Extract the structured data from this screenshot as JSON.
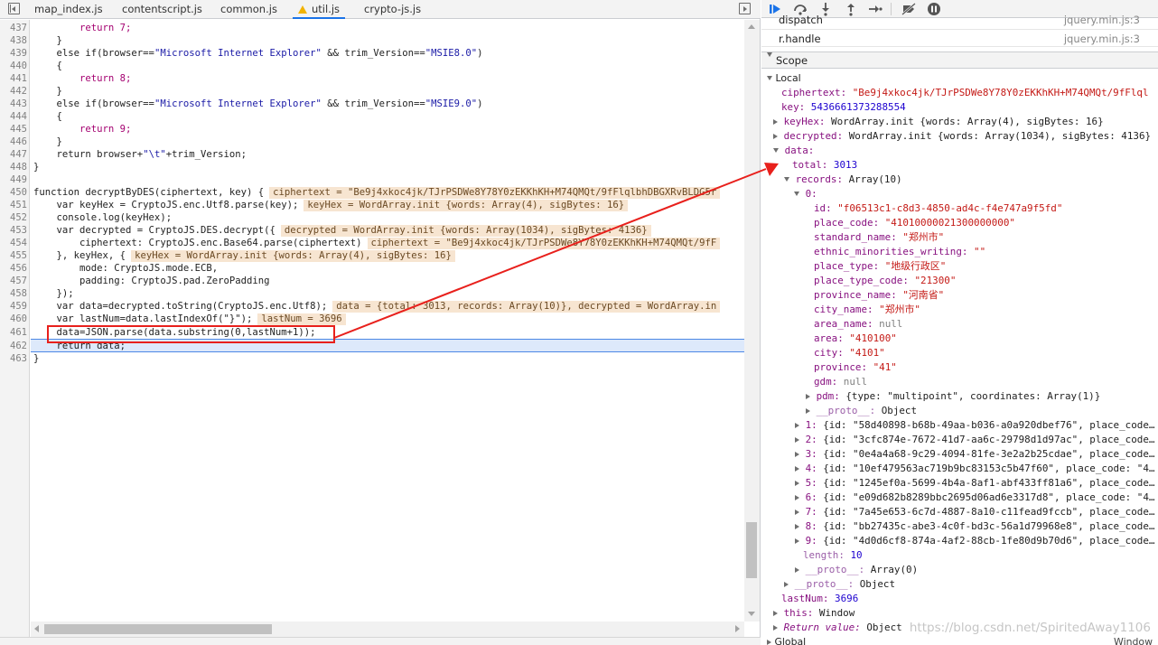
{
  "tabs": [
    {
      "label": "map_index.js"
    },
    {
      "label": "contentscript.js"
    },
    {
      "label": "common.js"
    },
    {
      "label": "util.js"
    },
    {
      "label": "crypto-js.js"
    }
  ],
  "code": {
    "line_numbers": [
      "437",
      "438",
      "439",
      "440",
      "441",
      "442",
      "443",
      "444",
      "445",
      "446",
      "447",
      "448",
      "449",
      "450",
      "451",
      "452",
      "453",
      "454",
      "455",
      "456",
      "457",
      "458",
      "459",
      "460",
      "461",
      "462",
      "463"
    ],
    "l437": "        return 7;",
    "l438": "    }",
    "l439a": "    else if(browser==",
    "l439b": "\"Microsoft Internet Explorer\"",
    "l439c": " && trim_Version==",
    "l439d": "\"MSIE8.0\"",
    "l439e": ")",
    "l440": "    {",
    "l441": "        return 8;",
    "l442": "    }",
    "l443a": "    else if(browser==",
    "l443b": "\"Microsoft Internet Explorer\"",
    "l443c": " && trim_Version==",
    "l443d": "\"MSIE9.0\"",
    "l443e": ")",
    "l444": "    {",
    "l445": "        return 9;",
    "l446": "    }",
    "l447a": "    return browser+",
    "l447b": "\"\\t\"",
    "l447c": "+trim_Version;",
    "l448": "}",
    "l449": "",
    "l450": "function decryptByDES(ciphertext, key) {",
    "l450i": "ciphertext = \"Be9j4xkoc4jk/TJrPSDWe8Y78Y0zEKKhKH+M74QMQt/9fFlqlbhDBGXRvBLDG5r",
    "l451": "    var keyHex = CryptoJS.enc.Utf8.parse(key);",
    "l451i": "keyHex = WordArray.init {words: Array(4), sigBytes: 16}",
    "l452": "    console.log(keyHex);",
    "l453": "    var decrypted = CryptoJS.DES.decrypt({",
    "l453i": "decrypted = WordArray.init {words: Array(1034), sigBytes: 4136}",
    "l454": "        ciphertext: CryptoJS.enc.Base64.parse(ciphertext)",
    "l454i": "ciphertext = \"Be9j4xkoc4jk/TJrPSDWe8Y78Y0zEKKhKH+M74QMQt/9fF",
    "l455": "    }, keyHex, {",
    "l455i": "keyHex = WordArray.init {words: Array(4), sigBytes: 16}",
    "l456": "        mode: CryptoJS.mode.ECB,",
    "l457": "        padding: CryptoJS.pad.ZeroPadding",
    "l458": "    });",
    "l459": "    var data=decrypted.toString(CryptoJS.enc.Utf8);",
    "l459i": "data = {total: 3013, records: Array(10)}, decrypted = WordArray.in",
    "l460": "    var lastNum=data.lastIndexOf(\"}\");",
    "l460i": "lastNum = 3696",
    "l461": "    data=JSON.parse(data.substring(0,lastNum+1));",
    "l462": "    return data;",
    "l463": "}"
  },
  "callstack": [
    {
      "name": "dispatch",
      "file": "jquery.min.js:3"
    },
    {
      "name": "r.handle",
      "file": "jquery.min.js:3"
    }
  ],
  "scope": {
    "header": "Scope",
    "local": "Local",
    "ciphertext_key": "ciphertext:",
    "ciphertext_val": "\"Be9j4xkoc4jk/TJrPSDWe8Y78Y0zEKKhKH+M74QMQt/9fFlql",
    "key_key": "key:",
    "key_val": "5436661373288554",
    "keyHex_key": "keyHex:",
    "keyHex_val": "WordArray.init {words: Array(4), sigBytes: 16}",
    "decrypted_key": "decrypted:",
    "decrypted_val": "WordArray.init {words: Array(1034), sigBytes: 4136}",
    "data_key": "data:",
    "total_key": "total:",
    "total_val": "3013",
    "records_key": "records:",
    "records_val": "Array(10)",
    "rec0_key": "0:",
    "fields": [
      {
        "k": "id:",
        "v": "\"f06513c1-c8d3-4850-ad4c-f4e747a9f5fd\"",
        "t": "s"
      },
      {
        "k": "place_code:",
        "v": "\"41010000021300000000\"",
        "t": "s"
      },
      {
        "k": "standard_name:",
        "v": "\"郑州市\"",
        "t": "s"
      },
      {
        "k": "ethnic_minorities_writing:",
        "v": "\"\"",
        "t": "s"
      },
      {
        "k": "place_type:",
        "v": "\"地级行政区\"",
        "t": "s"
      },
      {
        "k": "place_type_code:",
        "v": "\"21300\"",
        "t": "s"
      },
      {
        "k": "province_name:",
        "v": "\"河南省\"",
        "t": "s"
      },
      {
        "k": "city_name:",
        "v": "\"郑州市\"",
        "t": "s"
      },
      {
        "k": "area_name:",
        "v": "null",
        "t": "null"
      },
      {
        "k": "area:",
        "v": "\"410100\"",
        "t": "s"
      },
      {
        "k": "city:",
        "v": "\"4101\"",
        "t": "s"
      },
      {
        "k": "province:",
        "v": "\"41\"",
        "t": "s"
      },
      {
        "k": "gdm:",
        "v": "null",
        "t": "null"
      }
    ],
    "pdm_key": "pdm:",
    "pdm_val": "{type: \"multipoint\", coordinates: Array(1)}",
    "proto_key": "__proto__:",
    "proto_obj": "Object",
    "records_rest": [
      {
        "k": "1:",
        "v": "{id: \"58d40898-b68b-49aa-b036-a0a920dbef76\", place_code…"
      },
      {
        "k": "2:",
        "v": "{id: \"3cfc874e-7672-41d7-aa6c-29798d1d97ac\", place_code…"
      },
      {
        "k": "3:",
        "v": "{id: \"0e4a4a68-9c29-4094-81fe-3e2a2b25cdae\", place_code…"
      },
      {
        "k": "4:",
        "v": "{id: \"10ef479563ac719b9bc83153c5b47f60\", place_code: \"4…"
      },
      {
        "k": "5:",
        "v": "{id: \"1245ef0a-5699-4b4a-8af1-abf433ff81a6\", place_code…"
      },
      {
        "k": "6:",
        "v": "{id: \"e09d682b8289bbc2695d06ad6e3317d8\", place_code: \"4…"
      },
      {
        "k": "7:",
        "v": "{id: \"7a45e653-6c7d-4887-8a10-c11fead9fccb\", place_code…"
      },
      {
        "k": "8:",
        "v": "{id: \"bb27435c-abe3-4c0f-bd3c-56a1d79968e8\", place_code…"
      },
      {
        "k": "9:",
        "v": "{id: \"4d0d6cf8-874a-4af2-88cb-1fe80d9b70d6\", place_code…"
      }
    ],
    "length_key": "length:",
    "length_val": "10",
    "proto_arr": "Array(0)",
    "lastNum_key": "lastNum:",
    "lastNum_val": "3696",
    "this_key": "this:",
    "this_val": "Window",
    "return_key": "Return value:",
    "return_val": "Object",
    "global": "Global",
    "global_val": "Window"
  },
  "watermark": "https://blog.csdn.net/SpiritedAway1106",
  "colors": {
    "annotation": "#e8201c",
    "accent": "#1a73e8"
  }
}
